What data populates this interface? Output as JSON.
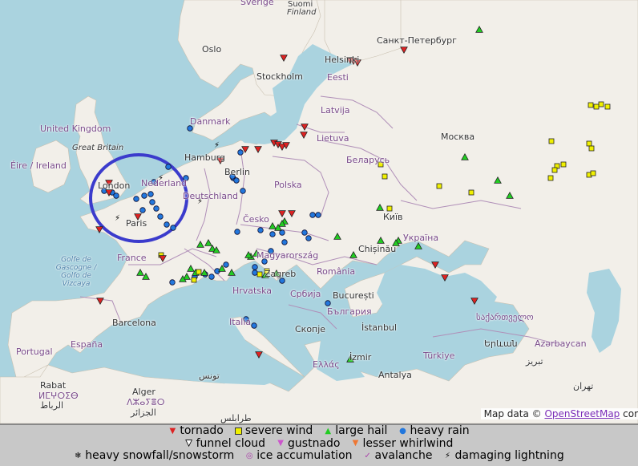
{
  "map": {
    "labels": {
      "sverige": "Sverige",
      "suomi": "Suomi",
      "finland_sub": "Finland",
      "oslo": "Oslo",
      "stockholm": "Stockholm",
      "helsinki": "Helsinki",
      "spb": "Санкт-Петербург",
      "eesti": "Eesti",
      "latvija": "Latvija",
      "danmark": "Danmark",
      "lietuva": "Lietuva",
      "uk": "United Kingdom",
      "gb": "Great Britain",
      "eire": "Éire / Ireland",
      "moskva": "Москва",
      "hamburg": "Hamburg",
      "berlin": "Berlin",
      "belarus": "Беларусь",
      "nederland": "Nederland",
      "london": "London",
      "deutschland": "Deutschland",
      "polska": "Polska",
      "cesko": "Česko",
      "kyiv": "Київ",
      "paris": "Paris",
      "ukraina": "Україна",
      "france": "France",
      "magyar": "Magyarország",
      "chisinau": "Chișinău",
      "gascogne": "Golfe de Gascogne / Golfo de Vizcaya",
      "zagreb": "Zagreb",
      "romania": "România",
      "hrvatska": "Hrvatska",
      "srbija": "Србија",
      "bucuresti": "București",
      "bulgaria": "България",
      "barcelona": "Barcelona",
      "italia": "Italia",
      "skopje": "Скопје",
      "istanbul": "İstanbul",
      "georgia": "საქართველო",
      "portugal": "Portugal",
      "espana": "España",
      "izmir": "İzmir",
      "turkiye": "Türkiye",
      "azerbaycan": "Azərbaycan",
      "erevan": "Երևան",
      "tabriz": "تبریز",
      "ellas": "Ελλάς",
      "antalya": "Antalya",
      "tunis": "تونس",
      "rabat": "Rabat",
      "morocco_tif": "ⵍⵎⵖⵔⵉⴱ",
      "rabat_ar": "الرباط",
      "alger": "Alger",
      "alger_tif": "ⴷⵣⴰⵢⴻⵔ",
      "alger_ar": "الجزائر",
      "tarabulus": "طرابلس",
      "tehran": "تهران"
    },
    "attribution_text": "Map data ©",
    "attribution_link": "OpenStreetMap",
    "attribution_tail": "cor",
    "highlight_color": "#3b3bcc"
  },
  "legend": {
    "row1": [
      "tornado",
      "severe wind",
      "large hail",
      "heavy rain"
    ],
    "row2": [
      "funnel cloud",
      "gustnado",
      "lesser whirlwind"
    ],
    "row3": [
      "heavy snowfall/snowstorm",
      "ice accumulation",
      "avalanche",
      "damaging lightning"
    ]
  },
  "colors": {
    "tornado": "#dd2222",
    "severe_wind": "#f0f000",
    "large_hail": "#22cc22",
    "heavy_rain": "#2277dd",
    "land": "#f2efe9",
    "water": "#aad3df",
    "border": "#b08fb8"
  }
}
